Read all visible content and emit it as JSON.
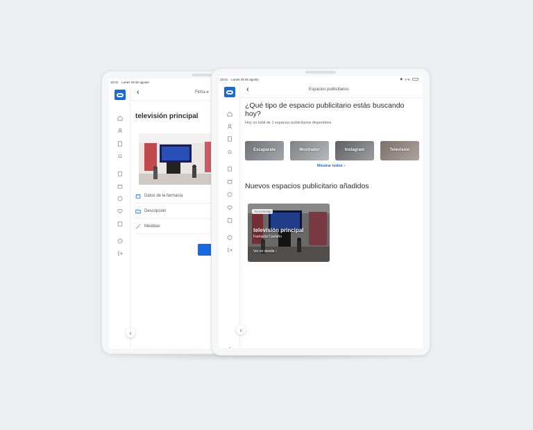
{
  "left_tablet": {
    "status_time": "15:01",
    "status_date": "Lunes 29 de agosto",
    "topbar_title": "Ficha e",
    "page_title": "televisión principal",
    "rows": [
      {
        "label": "Datos de la farmacia",
        "icon": "store-icon"
      },
      {
        "label": "Descripción",
        "icon": "folder-icon"
      },
      {
        "label": "Medidas",
        "icon": "ruler-icon"
      }
    ]
  },
  "right_tablet": {
    "status_time": "15:01",
    "status_date": "Lunes 29 de agosto",
    "status_battery": "4 %",
    "topbar_title": "Espacios publicitarios",
    "heading": "¿Qué tipo de espacio publicitario estás buscando hoy?",
    "subtext": "Hoy un total de 1 espacios publicitarios disponibles",
    "categories": [
      "Escaparate",
      "Mostrador",
      "Instagram",
      "Televisión"
    ],
    "show_all": "Mostrar todos",
    "new_heading": "Nuevos espacios publicitario añadidos",
    "card": {
      "tag": "TELEVISIÓN",
      "title": "televisión principal",
      "subtitle": "Farmacia Castaño",
      "link": "Ver en detalle"
    }
  },
  "nav_icons": [
    "home-icon",
    "user-icon",
    "document-icon",
    "bell-icon",
    "clipboard-icon",
    "store-icon",
    "smile-icon",
    "heart-icon",
    "calendar-icon",
    "help-icon",
    "logout-icon"
  ],
  "colors": {
    "accent": "#1769e0",
    "background": "#eceef1"
  }
}
